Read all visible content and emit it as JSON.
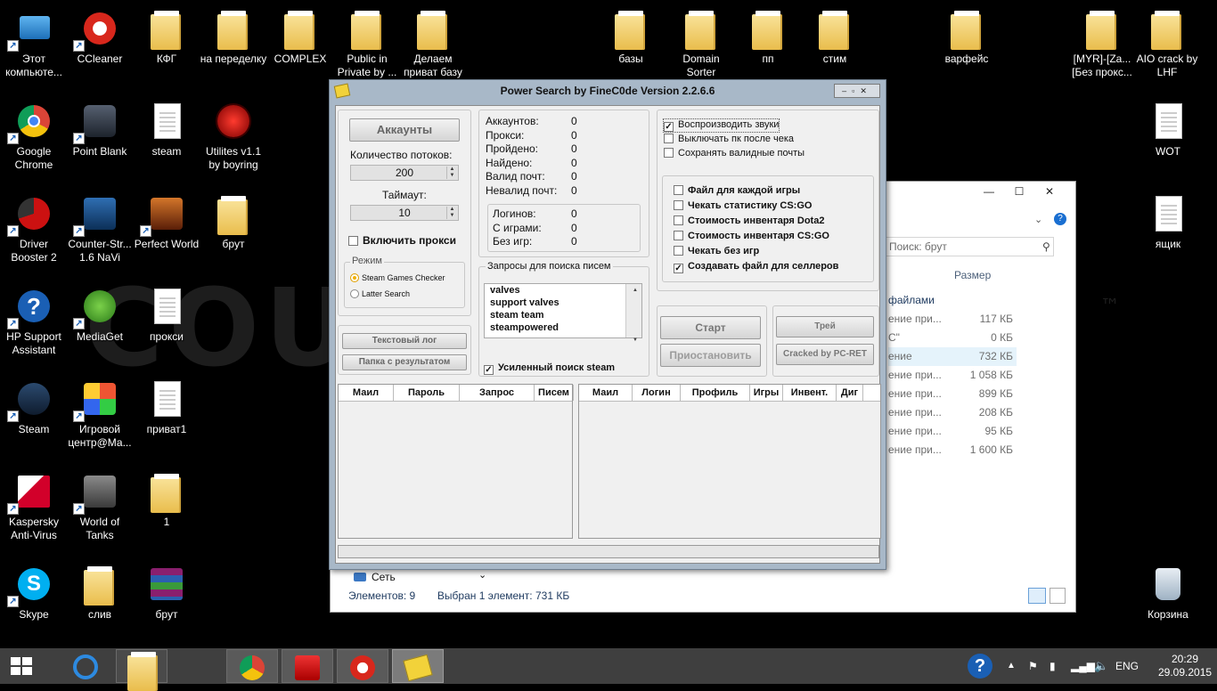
{
  "desktop": {
    "watermark_left": "COU",
    "watermark_right": "™",
    "icons": [
      {
        "label": "Этот компьюте...",
        "icon": "computer-icon"
      },
      {
        "label": "CCleaner",
        "icon": "ccleaner-icon"
      },
      {
        "label": "КФГ",
        "icon": "folder-icon"
      },
      {
        "label": "на переделку",
        "icon": "folder-icon"
      },
      {
        "label": "COMPLEX",
        "icon": "folder-icon"
      },
      {
        "label": "Public in Private by ...",
        "icon": "folder-icon"
      },
      {
        "label": "Делаем приват базу",
        "icon": "folder-icon"
      },
      {
        "label": "базы",
        "icon": "folder-icon"
      },
      {
        "label": "Domain Sorter",
        "icon": "folder-icon"
      },
      {
        "label": "пп",
        "icon": "folder-icon"
      },
      {
        "label": "стим",
        "icon": "folder-icon"
      },
      {
        "label": "варфейс",
        "icon": "folder-icon"
      },
      {
        "label": "[MYR]-[Za... [Без прокс...",
        "icon": "folder-icon"
      },
      {
        "label": "AIO crack by LHF",
        "icon": "folder-icon"
      },
      {
        "label": "Google Chrome",
        "icon": "chrome-icon"
      },
      {
        "label": "Point Blank",
        "icon": "point-blank-icon"
      },
      {
        "label": "steam",
        "icon": "text-file-icon"
      },
      {
        "label": "Utilites v1.1 by boyring",
        "icon": "utilites-icon"
      },
      {
        "label": "WOT",
        "icon": "text-file-icon"
      },
      {
        "label": "Driver Booster 2",
        "icon": "driver-booster-icon"
      },
      {
        "label": "Counter-Str... 1.6 NaVi",
        "icon": "counter-strike-icon"
      },
      {
        "label": "Perfect World",
        "icon": "perfect-world-icon"
      },
      {
        "label": "брут",
        "icon": "folder-icon"
      },
      {
        "label": "ящик",
        "icon": "text-file-icon"
      },
      {
        "label": "HP Support Assistant",
        "icon": "hp-support-icon"
      },
      {
        "label": "MediaGet",
        "icon": "mediaget-icon"
      },
      {
        "label": "прокси",
        "icon": "text-file-icon"
      },
      {
        "label": "Steam",
        "icon": "steam-icon"
      },
      {
        "label": "Игровой центр@Ма...",
        "icon": "game-center-icon"
      },
      {
        "label": "приват1",
        "icon": "text-file-icon"
      },
      {
        "label": "Kaspersky Anti-Virus",
        "icon": "kaspersky-icon"
      },
      {
        "label": "World of Tanks",
        "icon": "world-of-tanks-icon"
      },
      {
        "label": "1",
        "icon": "folder-icon"
      },
      {
        "label": "Skype",
        "icon": "skype-icon"
      },
      {
        "label": "слив",
        "icon": "folder-icon"
      },
      {
        "label": "брут",
        "icon": "winrar-icon"
      },
      {
        "label": "Корзина",
        "icon": "recycle-bin-icon"
      }
    ]
  },
  "explorer": {
    "search_placeholder": "Поиск: брут",
    "column_size": "Размер",
    "group_header": "файлами",
    "rows": [
      {
        "name": "ение при...",
        "size": "117 КБ"
      },
      {
        "name": "С\"",
        "size": "0 КБ"
      },
      {
        "name": "ение",
        "size": "732 КБ"
      },
      {
        "name": "ение при...",
        "size": "1 058 КБ"
      },
      {
        "name": "ение при...",
        "size": "899 КБ"
      },
      {
        "name": "ение при...",
        "size": "208 КБ"
      },
      {
        "name": "ение при...",
        "size": "95 КБ"
      },
      {
        "name": "ение при...",
        "size": "1 600 КБ"
      }
    ],
    "network_label": "Сеть",
    "status_items": "Элементов: 9",
    "status_selected": "Выбран 1 элемент: 731 КБ"
  },
  "app": {
    "title": "Power Search by FineC0de Version 2.2.6.6",
    "accounts_button": "Аккаунты",
    "threads_label": "Количество потоков:",
    "threads_value": "200",
    "timeout_label": "Таймаут:",
    "timeout_value": "10",
    "enable_proxy": "Включить прокси",
    "mode_legend": "Режим",
    "mode_options": [
      "Steam Games Checker",
      "Latter Search"
    ],
    "text_log_button": "Текстовый лог",
    "results_folder_button": "Папка с результатом",
    "stats": [
      {
        "label": "Аккаунтов:",
        "value": "0"
      },
      {
        "label": "Прокси:",
        "value": "0"
      },
      {
        "label": "Пройдено:",
        "value": "0"
      },
      {
        "label": "Найдено:",
        "value": "0"
      },
      {
        "label": "Валид почт:",
        "value": "0"
      },
      {
        "label": "Невалид почт:",
        "value": "0"
      }
    ],
    "substats": [
      {
        "label": "Логинов:",
        "value": "0"
      },
      {
        "label": "С играми:",
        "value": "0"
      },
      {
        "label": "Без игр:",
        "value": "0"
      }
    ],
    "queries_legend": "Запросы для поиска писем",
    "queries": [
      "valves",
      "support valves",
      "steam team",
      "steampowered"
    ],
    "enhanced_search": "Усиленный поиск steam",
    "options_top": [
      {
        "label": "Воспроизводить звуки",
        "checked": true
      },
      {
        "label": "Выключать пк после чека",
        "checked": false
      },
      {
        "label": "Сохранять валидные почты",
        "checked": false
      }
    ],
    "options_bottom": [
      {
        "label": "Файл для каждой игры",
        "checked": false
      },
      {
        "label": "Чекать статистику CS:GO",
        "checked": false
      },
      {
        "label": "Стоимость инвентаря Dota2",
        "checked": false
      },
      {
        "label": "Стоимость инвентаря CS:GO",
        "checked": false
      },
      {
        "label": "Чекать без игр",
        "checked": false
      },
      {
        "label": "Создавать файл для селлеров",
        "checked": true
      }
    ],
    "start_button": "Старт",
    "pause_button": "Приостановить",
    "tray_button": "Трей",
    "cracked_button": "Cracked by PC-RET",
    "left_table_headers": [
      "Маил",
      "Пароль",
      "Запрос",
      "Писем"
    ],
    "right_table_headers": [
      "Маил",
      "Логин",
      "Профиль",
      "Игры",
      "Инвент.",
      "Диг"
    ]
  },
  "taskbar": {
    "apps": [
      "file-explorer-icon",
      "internet-explorer-icon",
      "chrome-icon",
      "game-center-icon",
      "ccleaner-icon",
      "power-search-icon"
    ],
    "language": "ENG",
    "time": "20:29",
    "date": "29.09.2015"
  }
}
